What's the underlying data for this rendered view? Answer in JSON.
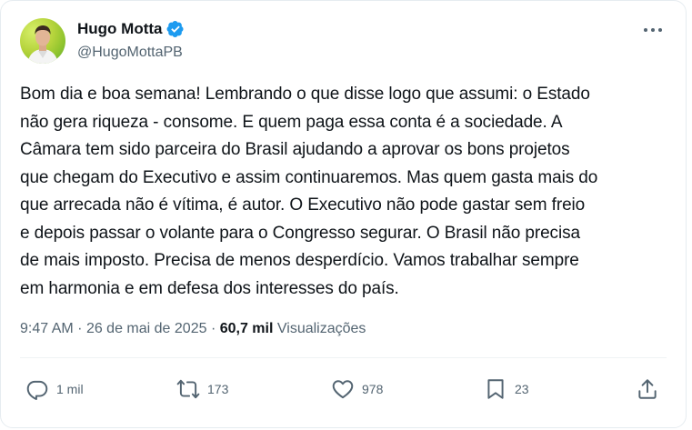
{
  "author": {
    "name": "Hugo Motta",
    "handle": "@HugoMottaPB",
    "verified_color": "#1d9bf0"
  },
  "tweet": {
    "text": "Bom dia e boa semana! Lembrando o que disse logo que assumi: o Estado\nnão gera riqueza - consome. E quem paga essa conta é a sociedade. A\nCâmara tem sido parceira do Brasil ajudando a aprovar os bons projetos\nque chegam do Executivo e assim continuaremos. Mas quem gasta mais do\nque arrecada não é vítima, é autor. O Executivo não pode gastar sem freio\ne depois passar o volante para o Congresso segurar. O Brasil não precisa\nde mais imposto. Precisa de menos desperdício. Vamos trabalhar sempre\nem harmonia e em defesa dos interesses do país."
  },
  "meta": {
    "time": "9:47 AM",
    "separator": "·",
    "date": "26 de mai de 2025",
    "views_count": "60,7 mil",
    "views_label": "Visualizações"
  },
  "actions": {
    "replies": "1 mil",
    "reposts": "173",
    "likes": "978",
    "bookmarks": "23"
  },
  "icons": {
    "more": "more-dots-icon",
    "reply": "reply-icon",
    "repost": "repost-icon",
    "like": "heart-icon",
    "bookmark": "bookmark-icon",
    "share": "share-icon",
    "verified": "verified-badge-icon"
  }
}
